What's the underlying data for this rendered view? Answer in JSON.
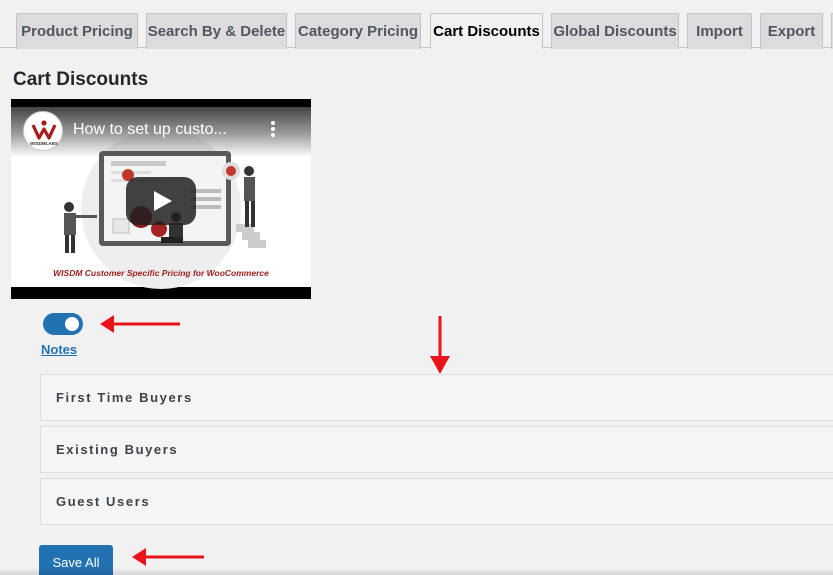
{
  "tabs": [
    {
      "label": "Product Pricing"
    },
    {
      "label": "Search By & Delete"
    },
    {
      "label": "Category Pricing"
    },
    {
      "label": "Cart Discounts",
      "active": true
    },
    {
      "label": "Global Discounts"
    },
    {
      "label": "Import"
    },
    {
      "label": "Export"
    }
  ],
  "page": {
    "title": "Cart Discounts"
  },
  "video": {
    "title": "How to set up custo...",
    "caption": "WISDM Customer Specific Pricing for WooCommerce",
    "channel_logo_text": "WISDMLABS"
  },
  "toggle": {
    "enabled": true
  },
  "notes": {
    "label": "Notes"
  },
  "sections": [
    {
      "label": "First Time Buyers"
    },
    {
      "label": "Existing Buyers"
    },
    {
      "label": "Guest Users"
    }
  ],
  "actions": {
    "save_label": "Save All"
  },
  "colors": {
    "accent": "#2271b1",
    "annotation_arrow": "#e8141b"
  }
}
